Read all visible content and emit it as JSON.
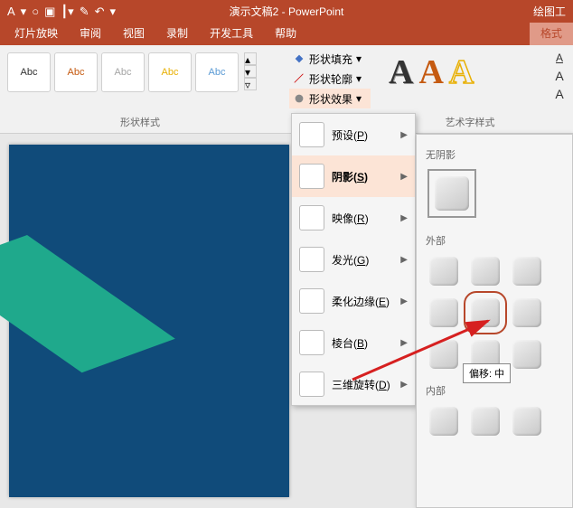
{
  "title": "演示文稿2 - PowerPoint",
  "title_right": "绘图工",
  "tabs": {
    "slideshow": "灯片放映",
    "review": "审阅",
    "view": "视图",
    "record": "录制",
    "developer": "开发工具",
    "help": "帮助",
    "format": "格式"
  },
  "style_thumb_text": "Abc",
  "group": {
    "shape_styles": "形状样式",
    "wordart_styles": "艺术字样式"
  },
  "shape": {
    "fill": "形状填充",
    "outline": "形状轮廓",
    "effects": "形状效果"
  },
  "effects_menu": {
    "preset": {
      "label": "预设",
      "key": "P"
    },
    "shadow": {
      "label": "阴影",
      "key": "S"
    },
    "reflection": {
      "label": "映像",
      "key": "R"
    },
    "glow": {
      "label": "发光",
      "key": "G"
    },
    "soft_edges": {
      "label": "柔化边缘",
      "key": "E"
    },
    "bevel": {
      "label": "棱台",
      "key": "B"
    },
    "rotation_3d": {
      "label": "三维旋转",
      "key": "D"
    }
  },
  "shadow_panel": {
    "none": "无阴影",
    "outer": "外部",
    "inner": "内部"
  },
  "tooltip": "偏移: 中"
}
